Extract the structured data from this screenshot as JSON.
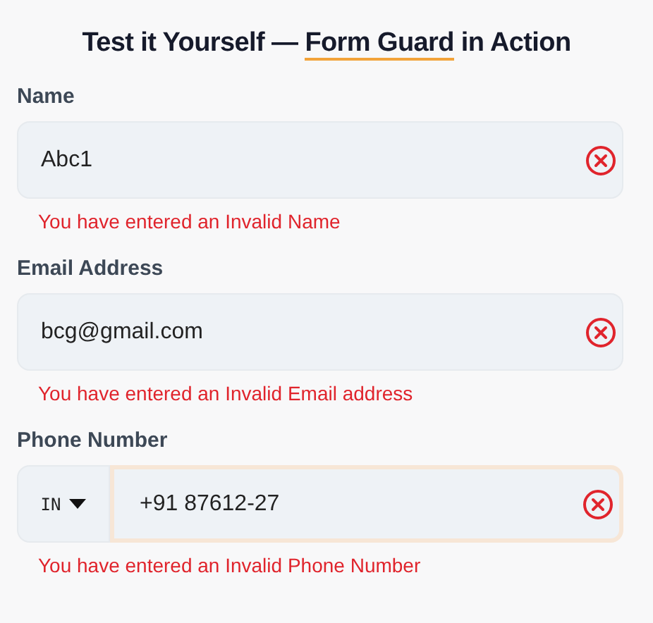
{
  "title": {
    "prefix": "Test it Yourself — ",
    "highlight": "Form Guard",
    "suffix": " in Action"
  },
  "fields": [
    {
      "kind": "text",
      "label": "Name",
      "value": "Abc1",
      "invalid": true,
      "focused": false,
      "error": "You have entered an Invalid Name"
    },
    {
      "kind": "text",
      "label": "Email Address",
      "value": "bcg@gmail.com",
      "invalid": true,
      "focused": false,
      "error": "You have entered an Invalid Email address"
    },
    {
      "kind": "phone",
      "label": "Phone Number",
      "country": "IN",
      "value": "+91 87612-27",
      "invalid": true,
      "focused": true,
      "error": "You have entered an Invalid Phone Number"
    }
  ]
}
